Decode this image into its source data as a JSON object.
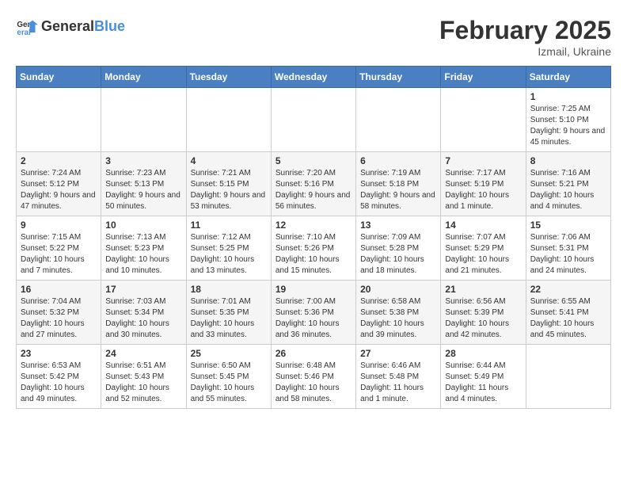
{
  "header": {
    "logo_general": "General",
    "logo_blue": "Blue",
    "month_title": "February 2025",
    "location": "Izmail, Ukraine"
  },
  "weekdays": [
    "Sunday",
    "Monday",
    "Tuesday",
    "Wednesday",
    "Thursday",
    "Friday",
    "Saturday"
  ],
  "weeks": [
    [
      {
        "day": "",
        "info": ""
      },
      {
        "day": "",
        "info": ""
      },
      {
        "day": "",
        "info": ""
      },
      {
        "day": "",
        "info": ""
      },
      {
        "day": "",
        "info": ""
      },
      {
        "day": "",
        "info": ""
      },
      {
        "day": "1",
        "info": "Sunrise: 7:25 AM\nSunset: 5:10 PM\nDaylight: 9 hours and 45 minutes."
      }
    ],
    [
      {
        "day": "2",
        "info": "Sunrise: 7:24 AM\nSunset: 5:12 PM\nDaylight: 9 hours and 47 minutes."
      },
      {
        "day": "3",
        "info": "Sunrise: 7:23 AM\nSunset: 5:13 PM\nDaylight: 9 hours and 50 minutes."
      },
      {
        "day": "4",
        "info": "Sunrise: 7:21 AM\nSunset: 5:15 PM\nDaylight: 9 hours and 53 minutes."
      },
      {
        "day": "5",
        "info": "Sunrise: 7:20 AM\nSunset: 5:16 PM\nDaylight: 9 hours and 56 minutes."
      },
      {
        "day": "6",
        "info": "Sunrise: 7:19 AM\nSunset: 5:18 PM\nDaylight: 9 hours and 58 minutes."
      },
      {
        "day": "7",
        "info": "Sunrise: 7:17 AM\nSunset: 5:19 PM\nDaylight: 10 hours and 1 minute."
      },
      {
        "day": "8",
        "info": "Sunrise: 7:16 AM\nSunset: 5:21 PM\nDaylight: 10 hours and 4 minutes."
      }
    ],
    [
      {
        "day": "9",
        "info": "Sunrise: 7:15 AM\nSunset: 5:22 PM\nDaylight: 10 hours and 7 minutes."
      },
      {
        "day": "10",
        "info": "Sunrise: 7:13 AM\nSunset: 5:23 PM\nDaylight: 10 hours and 10 minutes."
      },
      {
        "day": "11",
        "info": "Sunrise: 7:12 AM\nSunset: 5:25 PM\nDaylight: 10 hours and 13 minutes."
      },
      {
        "day": "12",
        "info": "Sunrise: 7:10 AM\nSunset: 5:26 PM\nDaylight: 10 hours and 15 minutes."
      },
      {
        "day": "13",
        "info": "Sunrise: 7:09 AM\nSunset: 5:28 PM\nDaylight: 10 hours and 18 minutes."
      },
      {
        "day": "14",
        "info": "Sunrise: 7:07 AM\nSunset: 5:29 PM\nDaylight: 10 hours and 21 minutes."
      },
      {
        "day": "15",
        "info": "Sunrise: 7:06 AM\nSunset: 5:31 PM\nDaylight: 10 hours and 24 minutes."
      }
    ],
    [
      {
        "day": "16",
        "info": "Sunrise: 7:04 AM\nSunset: 5:32 PM\nDaylight: 10 hours and 27 minutes."
      },
      {
        "day": "17",
        "info": "Sunrise: 7:03 AM\nSunset: 5:34 PM\nDaylight: 10 hours and 30 minutes."
      },
      {
        "day": "18",
        "info": "Sunrise: 7:01 AM\nSunset: 5:35 PM\nDaylight: 10 hours and 33 minutes."
      },
      {
        "day": "19",
        "info": "Sunrise: 7:00 AM\nSunset: 5:36 PM\nDaylight: 10 hours and 36 minutes."
      },
      {
        "day": "20",
        "info": "Sunrise: 6:58 AM\nSunset: 5:38 PM\nDaylight: 10 hours and 39 minutes."
      },
      {
        "day": "21",
        "info": "Sunrise: 6:56 AM\nSunset: 5:39 PM\nDaylight: 10 hours and 42 minutes."
      },
      {
        "day": "22",
        "info": "Sunrise: 6:55 AM\nSunset: 5:41 PM\nDaylight: 10 hours and 45 minutes."
      }
    ],
    [
      {
        "day": "23",
        "info": "Sunrise: 6:53 AM\nSunset: 5:42 PM\nDaylight: 10 hours and 49 minutes."
      },
      {
        "day": "24",
        "info": "Sunrise: 6:51 AM\nSunset: 5:43 PM\nDaylight: 10 hours and 52 minutes."
      },
      {
        "day": "25",
        "info": "Sunrise: 6:50 AM\nSunset: 5:45 PM\nDaylight: 10 hours and 55 minutes."
      },
      {
        "day": "26",
        "info": "Sunrise: 6:48 AM\nSunset: 5:46 PM\nDaylight: 10 hours and 58 minutes."
      },
      {
        "day": "27",
        "info": "Sunrise: 6:46 AM\nSunset: 5:48 PM\nDaylight: 11 hours and 1 minute."
      },
      {
        "day": "28",
        "info": "Sunrise: 6:44 AM\nSunset: 5:49 PM\nDaylight: 11 hours and 4 minutes."
      },
      {
        "day": "",
        "info": ""
      }
    ]
  ]
}
